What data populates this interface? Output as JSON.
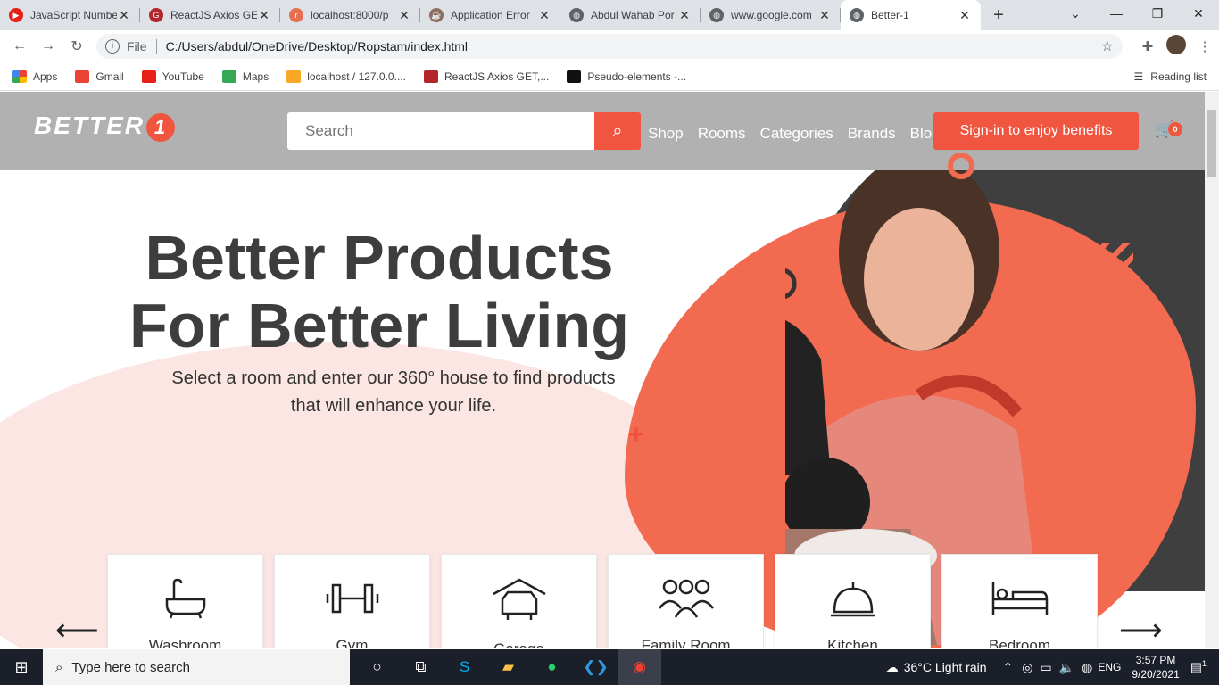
{
  "tabs": [
    {
      "title": "JavaScript Numbe",
      "color": "#e62117",
      "glyph": "▶"
    },
    {
      "title": "ReactJS Axios GE",
      "color": "#b3262b",
      "glyph": "G"
    },
    {
      "title": "localhost:8000/p",
      "color": "#e76f51",
      "glyph": "r"
    },
    {
      "title": "Application Error",
      "color": "#8d6e63",
      "glyph": "☕"
    },
    {
      "title": "Abdul Wahab Por",
      "color": "#5f6368",
      "glyph": "◍"
    },
    {
      "title": "www.google.com",
      "color": "#5f6368",
      "glyph": "◍"
    },
    {
      "title": "Better-1",
      "color": "#5f6368",
      "glyph": "◍"
    }
  ],
  "toolbar": {
    "file_label": "File",
    "url": "C:/Users/abdul/OneDrive/Desktop/Ropstam/index.html"
  },
  "bookmarks": [
    {
      "label": "Apps",
      "color": "#4285f4"
    },
    {
      "label": "Gmail",
      "color": "#ea4335"
    },
    {
      "label": "YouTube",
      "color": "#e62117"
    },
    {
      "label": "Maps",
      "color": "#34a853"
    },
    {
      "label": "localhost / 127.0.0....",
      "color": "#f9a825"
    },
    {
      "label": "ReactJS Axios GET,...",
      "color": "#b3262b"
    },
    {
      "label": "Pseudo-elements -...",
      "color": "#111111"
    }
  ],
  "reading_list": "Reading list",
  "site": {
    "logo": "BETTER",
    "logo_digit": "1",
    "search_placeholder": "Search",
    "nav": [
      "Shop",
      "Rooms",
      "Categories",
      "Brands",
      "Blog"
    ],
    "signin": "Sign-in to enjoy benefits",
    "cart_count": "0",
    "hero_line1": "Better Products",
    "hero_line2": "For Better Living",
    "hero_sub1": "Select a room and enter our 360° house to find products",
    "hero_sub2": "that will enhance your life.",
    "rooms": [
      "Washroom",
      "Gym",
      "Garage",
      "Family Room",
      "Kitchen",
      "Bedroom"
    ],
    "accent": "#f0553f"
  },
  "taskbar": {
    "search": "Type here to search",
    "weather": "36°C  Light rain",
    "lang": "ENG",
    "time": "3:57 PM",
    "date": "9/20/2021",
    "notif": "1"
  }
}
